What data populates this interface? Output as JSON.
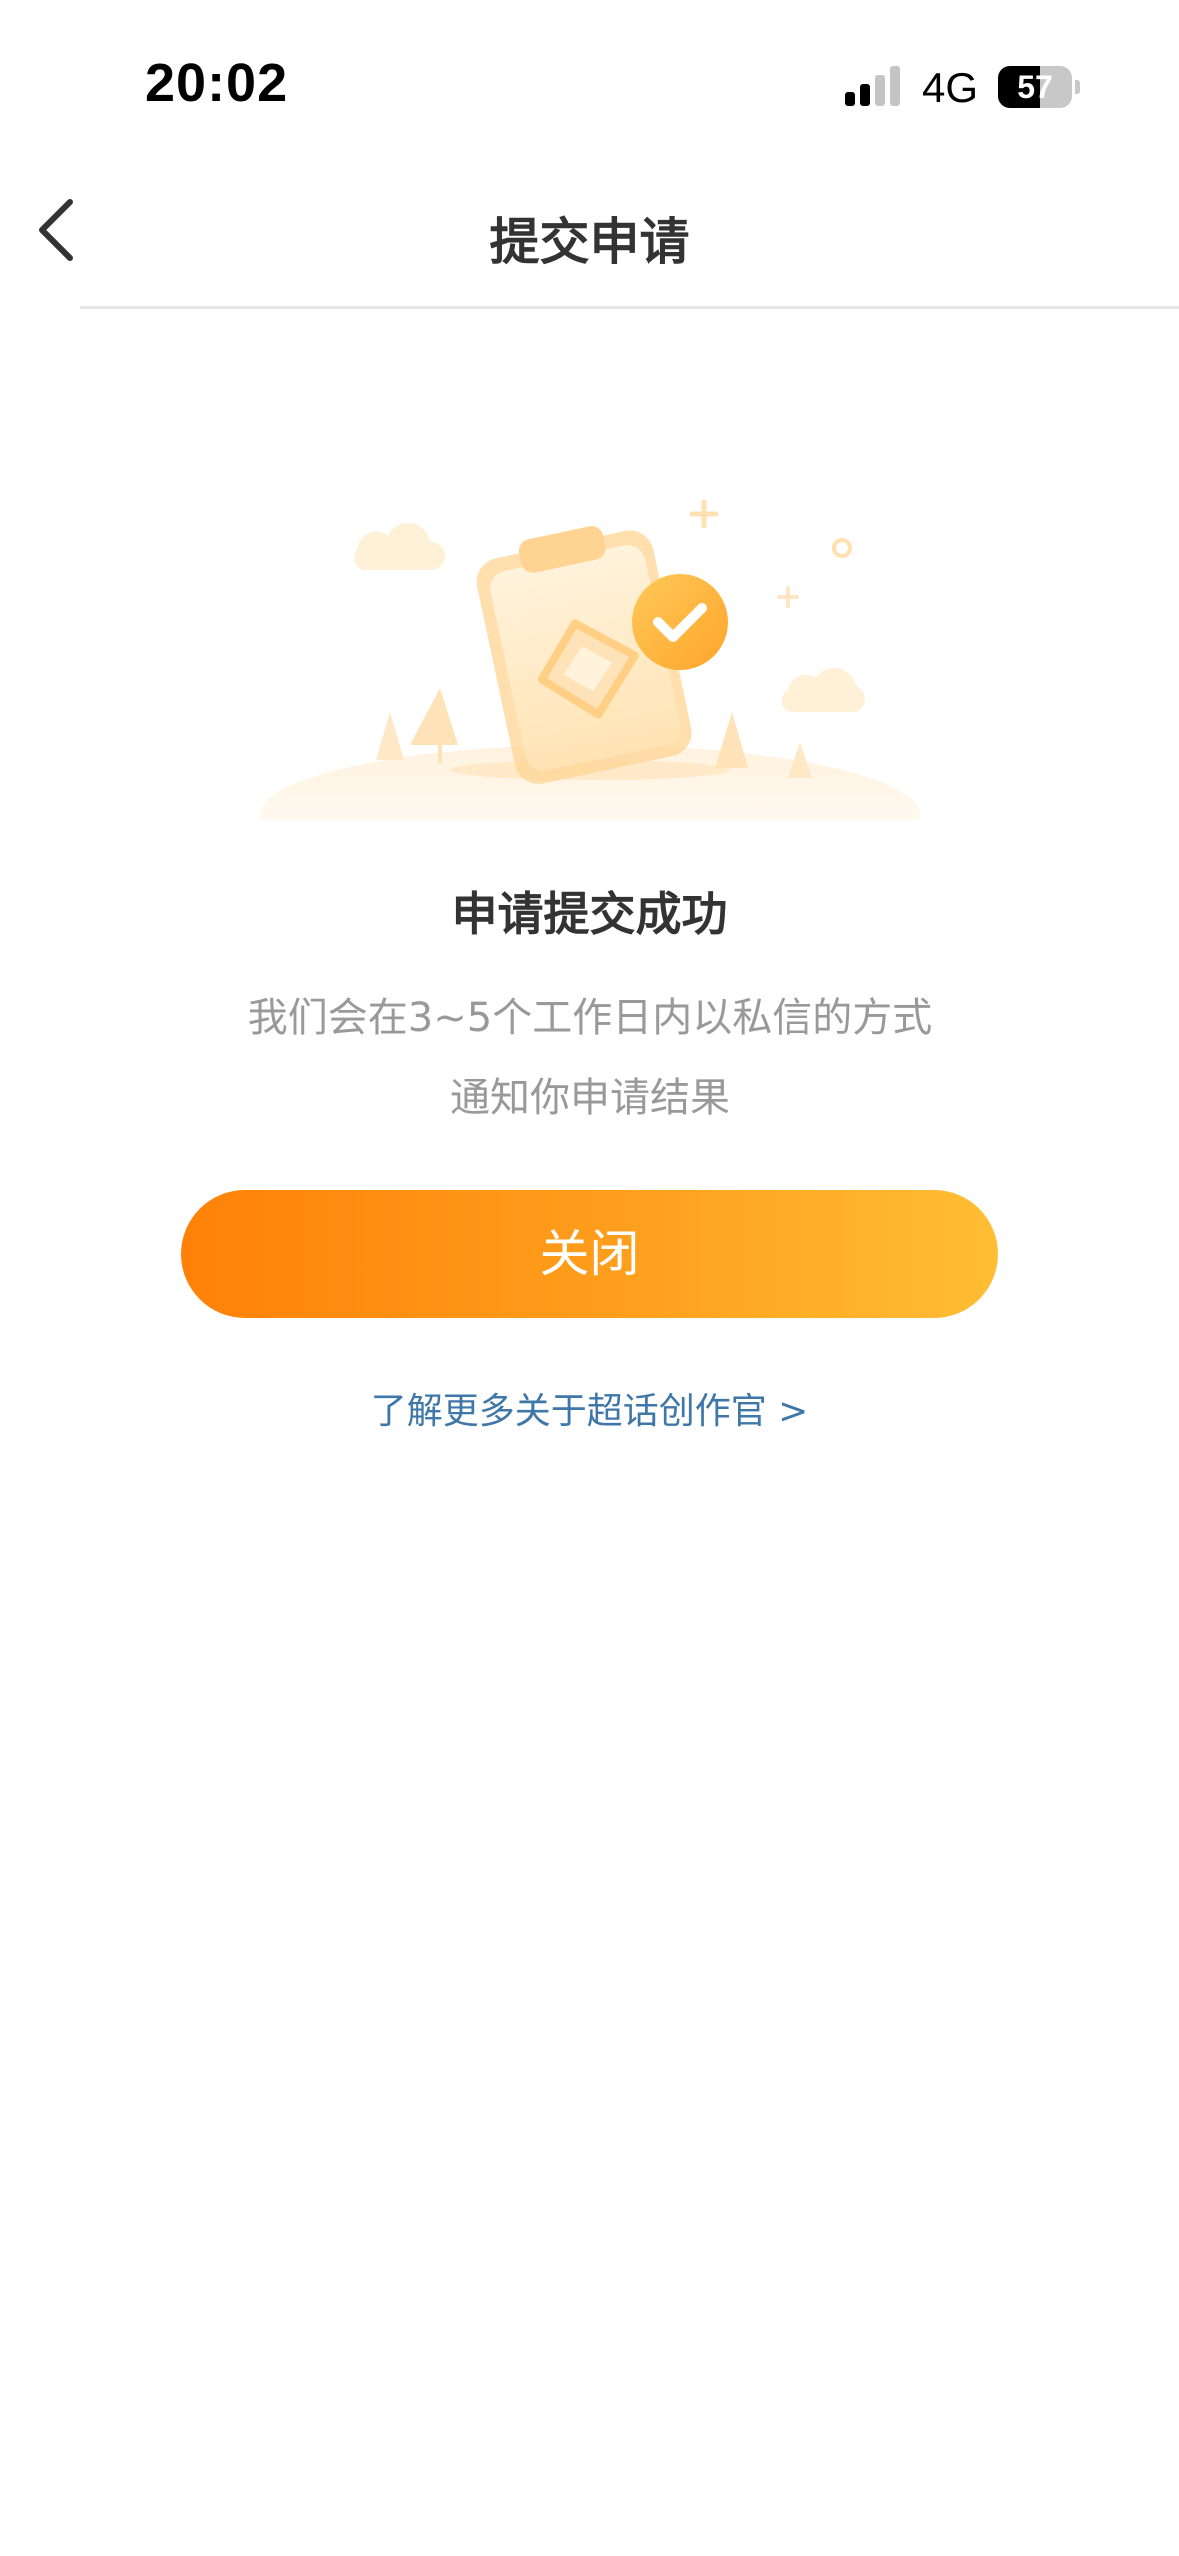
{
  "status_bar": {
    "time": "20:02",
    "network": "4G",
    "battery_level": 57,
    "battery_label": "57"
  },
  "nav": {
    "title": "提交申请",
    "back_icon": "chevron-left-icon"
  },
  "illustration": {
    "icon": "clipboard-check-illustration",
    "colors": {
      "primary": "#ffb53c",
      "light": "#ffe8c2"
    }
  },
  "result": {
    "title": "申请提交成功",
    "description_line1": "我们会在3~5个工作日内以私信的方式",
    "description_line2": "通知你申请结果"
  },
  "actions": {
    "close_label": "关闭",
    "learn_more_label": "了解更多关于超话创作官 >"
  },
  "colors": {
    "accent_start": "#ff8108",
    "accent_end": "#ffbe34",
    "link": "#3f77a9",
    "title": "#333333",
    "muted": "#999999"
  }
}
